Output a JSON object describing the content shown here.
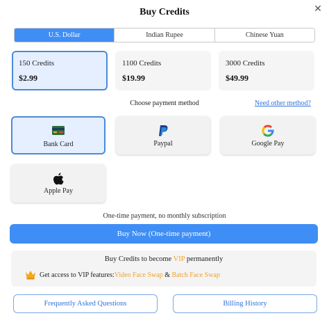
{
  "header": {
    "title": "Buy Credits",
    "close_glyph": "✕"
  },
  "currency_tabs": [
    "U.S. Dollar",
    "Indian Rupee",
    "Chinese Yuan"
  ],
  "selected_currency": "U.S. Dollar",
  "plans": [
    {
      "credits": "150 Credits",
      "price": "$2.99",
      "selected": true
    },
    {
      "credits": "1100 Credits",
      "price": "$19.99",
      "selected": false
    },
    {
      "credits": "3000 Credits",
      "price": "$49.99",
      "selected": false
    }
  ],
  "payment": {
    "label": "Choose payment method",
    "other_link": "Need other method?",
    "methods": [
      {
        "label": "Bank Card",
        "icon": "bank-card-icon",
        "selected": true
      },
      {
        "label": "Paypal",
        "icon": "paypal-icon",
        "selected": false
      },
      {
        "label": "Google Pay",
        "icon": "google-icon",
        "selected": false
      },
      {
        "label": "Apple Pay",
        "icon": "apple-icon",
        "selected": false
      }
    ]
  },
  "note": "One-time payment, no monthly subscription",
  "buy_button": "Buy Now (One-time payment)",
  "vip": {
    "title_prefix": "Buy Credits to become ",
    "title_vip": "VIP",
    "title_suffix": " permanently",
    "features_prefix": "Get access to VIP features: ",
    "feature_1": "Video Face Swap",
    "amp": " & ",
    "feature_2": "Batch Face Swap",
    "icon": "crown-icon"
  },
  "footer": {
    "faq": "Frequently Asked Questions",
    "billing": "Billing History"
  },
  "colors": {
    "accent": "#3f8ef5",
    "link": "#2f73da",
    "vip": "#f0a12b",
    "selected_border": "#4b8bd6"
  }
}
